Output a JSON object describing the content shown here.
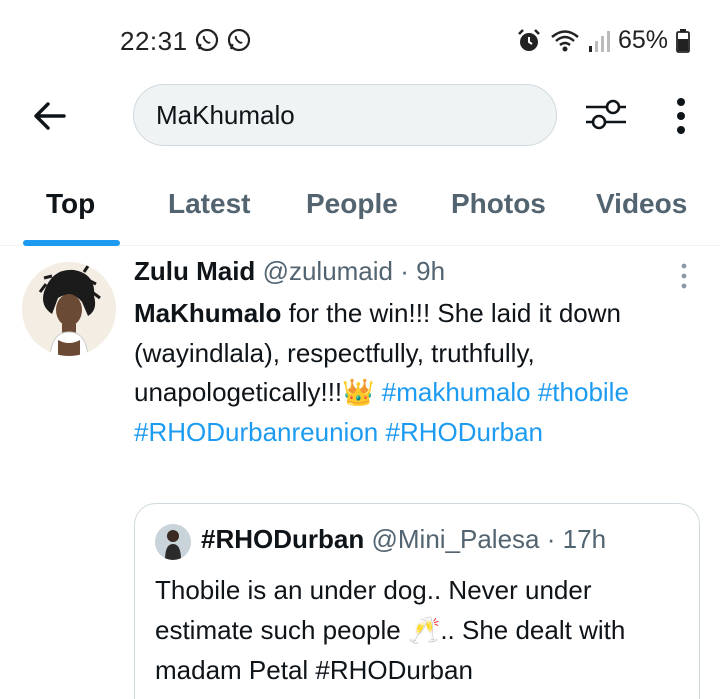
{
  "status_bar": {
    "time": "22:31",
    "battery": "65%",
    "icons": [
      "whatsapp-icon",
      "whatsapp-icon",
      "alarm-icon",
      "wifi-icon",
      "signal-icon",
      "battery-icon"
    ]
  },
  "search": {
    "query": "MaKhumalo"
  },
  "tabs": [
    {
      "label": "Top",
      "active": true
    },
    {
      "label": "Latest",
      "active": false
    },
    {
      "label": "People",
      "active": false
    },
    {
      "label": "Photos",
      "active": false
    },
    {
      "label": "Videos",
      "active": false
    }
  ],
  "tweet": {
    "name": "Zulu Maid",
    "handle": "@zulumaid",
    "separator": "·",
    "time": "9h",
    "highlight": "MaKhumalo",
    "text_main": " for the win!!! She laid it down (wayindlala), respectfully, truthfully, unapologetically!!!",
    "emoji": "👑",
    "hashtags": [
      "#makhumalo",
      "#thobile",
      "#RHODurbanreunion",
      "#RHODurban"
    ]
  },
  "quoted_tweet": {
    "name": "#RHODurban",
    "handle": "@Mini_Palesa",
    "separator": "·",
    "time": "17h",
    "text_before_emoji": "Thobile is an under dog.. Never under estimate such people ",
    "emoji": "🥂",
    "text_after_emoji": ".. She dealt with madam Petal ",
    "hashtag": "#RHODurban"
  },
  "colors": {
    "accent": "#1d9bf0",
    "text_primary": "#0f1419",
    "text_secondary": "#536471",
    "search_bg": "#eff3f4",
    "border": "#cfd9de"
  }
}
